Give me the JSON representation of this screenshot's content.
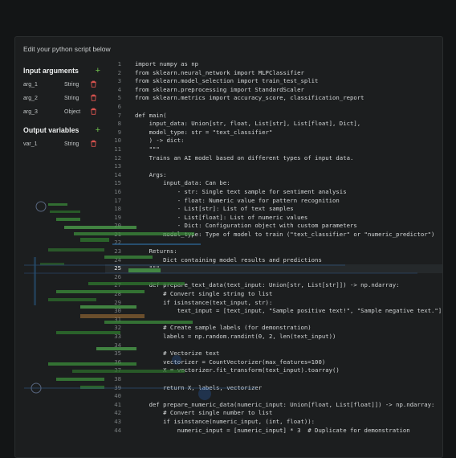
{
  "panel": {
    "title": "Edit your python script below"
  },
  "sidebar": {
    "inputs_heading": "Input arguments",
    "outputs_heading": "Output variables",
    "add_icon": "plus-icon",
    "delete_icon": "trash-icon",
    "accent_color": "#6fc24d",
    "delete_color": "#d9534f",
    "inputs": [
      {
        "name": "arg_1",
        "type": "String"
      },
      {
        "name": "arg_2",
        "type": "String"
      },
      {
        "name": "arg_3",
        "type": "Object"
      }
    ],
    "outputs": [
      {
        "name": "var_1",
        "type": "String"
      }
    ]
  },
  "editor": {
    "current_line": 25,
    "lines": [
      "import numpy as np",
      "from sklearn.neural_network import MLPClassifier",
      "from sklearn.model_selection import train_test_split",
      "from sklearn.preprocessing import StandardScaler",
      "from sklearn.metrics import accuracy_score, classification_report",
      "",
      "def main(",
      "    input_data: Union[str, float, List[str], List[float], Dict],",
      "    model_type: str = \"text_classifier\"",
      "    ) -> dict:",
      "    \"\"\"",
      "    Trains an AI model based on different types of input data.",
      "",
      "    Args:",
      "        input_data: Can be:",
      "            - str: Single text sample for sentiment analysis",
      "            - float: Numeric value for pattern recognition",
      "            - List[str]: List of text samples",
      "            - List[float]: List of numeric values",
      "            - Dict: Configuration object with custom parameters",
      "        model_type: Type of model to train (\"text_classifier\" or \"numeric_predictor\")",
      "",
      "    Returns:",
      "        Dict containing model results and predictions",
      "    \"\"\"",
      "",
      "    def prepare_text_data(text_input: Union[str, List[str]]) -> np.ndarray:",
      "        # Convert single string to list",
      "        if isinstance(text_input, str):",
      "            text_input = [text_input, \"Sample positive text!\", \"Sample negative text.\"]",
      "",
      "        # Create sample labels (for demonstration)",
      "        labels = np.random.randint(0, 2, len(text_input))",
      "",
      "        # Vectorize text",
      "        vectorizer = CountVectorizer(max_features=100)",
      "        X = vectorizer.fit_transform(text_input).toarray()",
      "",
      "        return X, labels, vectorizer",
      "",
      "    def prepare_numeric_data(numeric_input: Union[float, List[float]]) -> np.ndarray:",
      "        # Convert single number to list",
      "        if isinstance(numeric_input, (int, float)):",
      "            numeric_input = [numeric_input] * 3  # Duplicate for demonstration"
    ]
  }
}
